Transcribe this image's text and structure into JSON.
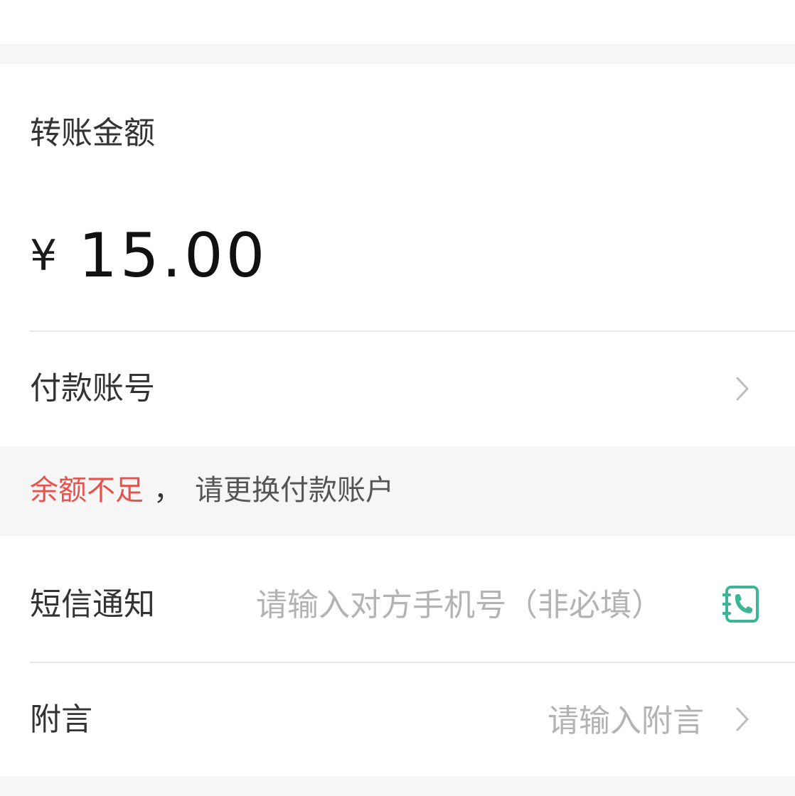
{
  "transfer": {
    "amount_label": "转账金额",
    "currency_symbol": "¥",
    "amount_value": "15.00"
  },
  "payment_account": {
    "label": "付款账号"
  },
  "warning": {
    "highlight": "余额不足",
    "separator": "，",
    "message": "请更换付款账户",
    "highlight_color": "#e8524c"
  },
  "sms_notice": {
    "label": "短信通知",
    "placeholder": "请输入对方手机号（非必填）",
    "value": "",
    "icon": "contact-book-phone-icon",
    "icon_color": "#3bb593"
  },
  "remark": {
    "label": "附言",
    "placeholder": "请输入附言"
  },
  "icons": {
    "chevron": "chevron-right-icon"
  }
}
